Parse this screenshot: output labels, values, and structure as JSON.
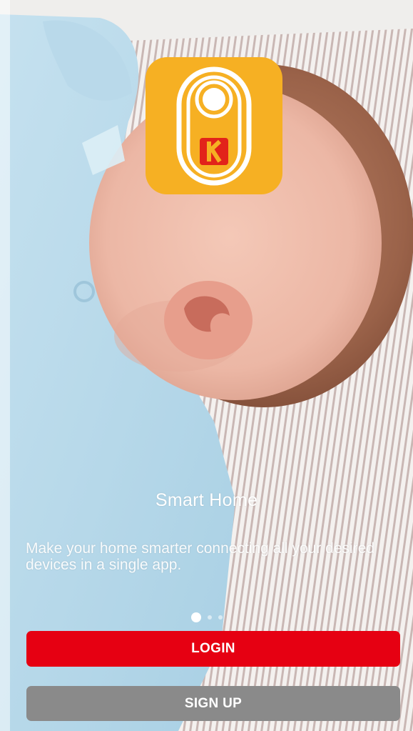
{
  "slide": {
    "title": "Smart Home",
    "description": "Make your home smarter connecting all your desired devices in a single app."
  },
  "carousel": {
    "page_count": 3,
    "active_index": 0
  },
  "buttons": {
    "login_label": "LOGIN",
    "signup_label": "SIGN UP"
  },
  "colors": {
    "logo_background": "#f6b023",
    "login_button": "#e60012",
    "signup_button": "#8a8a8a",
    "logo_mark_red": "#e2231a"
  },
  "icons": {
    "app_logo": "kodak-smart-home-app-icon"
  }
}
